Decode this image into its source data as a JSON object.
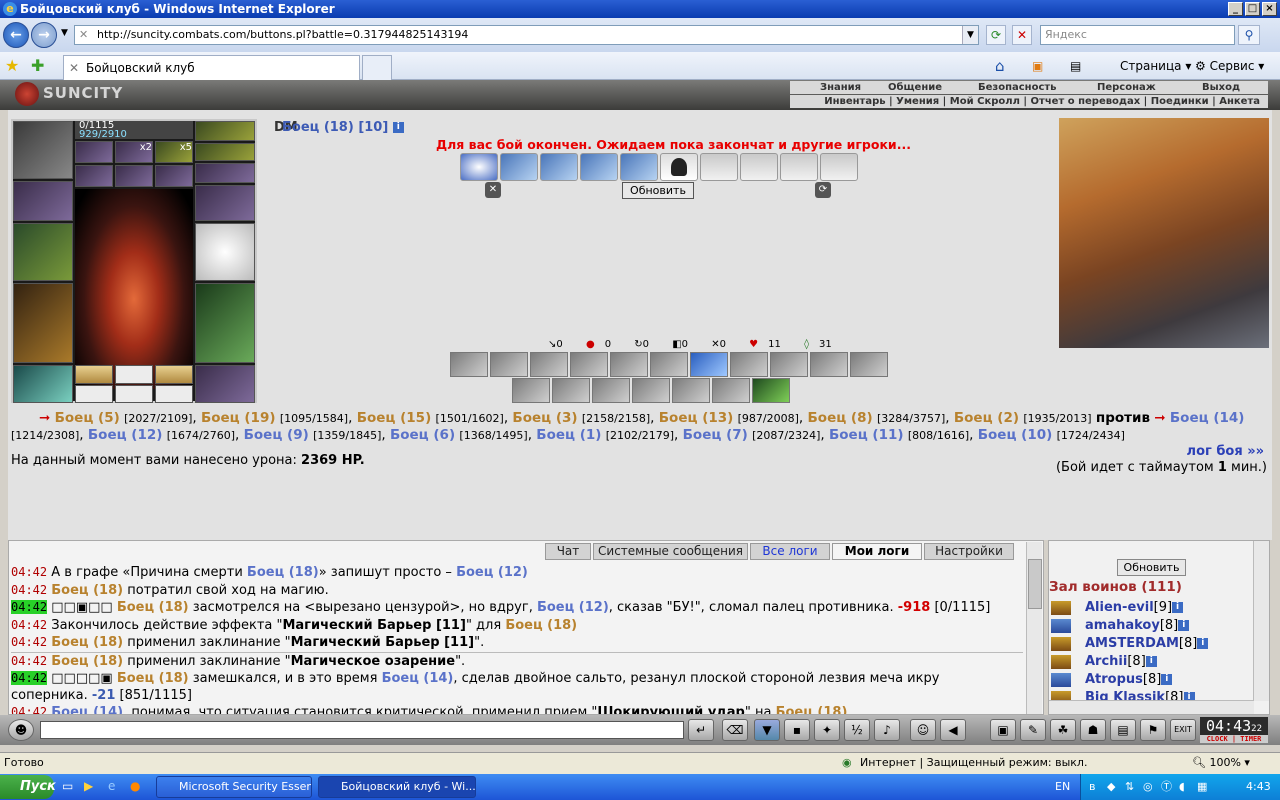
{
  "window": {
    "title": "Бойцовский клуб - Windows Internet Explorer"
  },
  "browser": {
    "url": "http://suncity.combats.com/buttons.pl?battle=0.317944825143194",
    "search_placeholder": "Яндекс",
    "tab_title": "Бойцовский клуб",
    "cmd_page": "Страница",
    "cmd_service": "Сервис"
  },
  "game": {
    "logo": "SUNCITY",
    "menu_top": [
      "Знания",
      "Общение",
      "Безопасность",
      "Персонаж",
      "Выход"
    ],
    "menu_bottom": "Инвентарь | Умения | Мой Скролл | Отчет о переводах | Поединки | Анкета",
    "hp": "0/1115",
    "mp": "929/2910",
    "slot_x2": "x2",
    "slot_x5": "x5",
    "mb": "DM",
    "player_name": "Боец (18) [10]",
    "end_message": "Для вас бой окончен. Ожидаем пока закончат и другие игроки...",
    "refresh": "Обновить",
    "counters": [
      "0",
      "0",
      "0",
      "0",
      "0",
      "11",
      "31"
    ],
    "team1": [
      {
        "name": "Боец (5)",
        "hp": "[2027/2109]"
      },
      {
        "name": "Боец (19)",
        "hp": "[1095/1584]"
      },
      {
        "name": "Боец (15)",
        "hp": "[1501/1602]"
      },
      {
        "name": "Боец (3)",
        "hp": "[2158/2158]"
      },
      {
        "name": "Боец (13)",
        "hp": "[987/2008]"
      },
      {
        "name": "Боец (8)",
        "hp": "[3284/3757]"
      },
      {
        "name": "Боец (2)",
        "hp": "[1935/2013]"
      }
    ],
    "vs": "против",
    "team2": [
      {
        "name": "Боец (14)",
        "hp": "[1214/2308]"
      },
      {
        "name": "Боец (12)",
        "hp": "[1674/2760]"
      },
      {
        "name": "Боец (9)",
        "hp": "[1359/1845]"
      },
      {
        "name": "Боец (6)",
        "hp": "[1368/1495]"
      },
      {
        "name": "Боец (1)",
        "hp": "[2102/2179]"
      },
      {
        "name": "Боец (7)",
        "hp": "[2087/2324]"
      },
      {
        "name": "Боец (11)",
        "hp": "[808/1616]"
      },
      {
        "name": "Боец (10)",
        "hp": "[1724/2434]"
      }
    ],
    "damage_label": "На данный момент вами нанесено урона:",
    "damage_value": "2369 HP.",
    "log_link": "лог боя »»",
    "timeout": "(Бой идет с таймаутом",
    "timeout_value": "1",
    "timeout_unit": "мин.)"
  },
  "log_tabs": [
    "Чат",
    "Системные сообщения",
    "Все логи",
    "Мои логи",
    "Настройки"
  ],
  "log": {
    "time": "04:42",
    "l1a": "А в графе «Причина смерти",
    "l1b": "Боец (18)",
    "l1c": "» запишут просто –",
    "l1d": "Боец (12)",
    "l2a": "Боец (18)",
    "l2b": "потратил свой ход на магию.",
    "l3pre": "□□▣□□",
    "l3a": "Боец (18)",
    "l3b": "засмотрелся на <вырезано цензурой>, но вдруг,",
    "l3c": "Боец (12)",
    "l3d": ", сказав \"БУ!\", сломал палец противника.",
    "l3dmg": "-918",
    "l3hp": "[0/1115]",
    "l4a": "Закончилось действие эффекта \"",
    "l4b": "Магический Барьер [11]",
    "l4c": "\" для",
    "l4d": "Боец (18)",
    "l5a": "Боец (18)",
    "l5b": "применил заклинание \"",
    "l5c": "Магический Барьер [11]",
    "l5d": "\".",
    "l6a": "Боец (18)",
    "l6b": "применил заклинание \"",
    "l6c": "Магическое озарение",
    "l6d": "\".",
    "l7pre": "□□□□▣",
    "l7a": "Боец (18)",
    "l7b": "замешкался, и в это время",
    "l7c": "Боец (14)",
    "l7d": ", сделав двойное сальто, резанул плоской стороной лезвия меча икру",
    "l7e": "соперника.",
    "l7dmg": "-21",
    "l7hp": "[851/1115]",
    "l8a": "Боец (14)",
    "l8b": ", понимая, что ситуация становится критической, применил прием \"",
    "l8c": "Шокирующий удар",
    "l8d": "\" на",
    "l8e": "Боец (18)",
    "l8f": "."
  },
  "hall": {
    "refresh": "Обновить",
    "title": "Зал воинов (111)",
    "players": [
      {
        "name": "Alien-evil",
        "lvl": "[9]"
      },
      {
        "name": "amahakoy",
        "lvl": "[8]"
      },
      {
        "name": "AMSTERDAM",
        "lvl": "[8]"
      },
      {
        "name": "Archii",
        "lvl": "[8]"
      },
      {
        "name": "Atropus",
        "lvl": "[8]"
      },
      {
        "name": "Big Klassik",
        "lvl": "[8]"
      }
    ]
  },
  "clock": {
    "time": "04:43",
    "sec": "22",
    "label": "CLOCK | TIMER"
  },
  "statusbar": {
    "ready": "Готово",
    "zone": "Интернет | Защищенный режим: выкл.",
    "zoom": "100%"
  },
  "taskbar": {
    "start": "Пуск",
    "tasks": [
      "Microsoft Security Essen...",
      "Бойцовский клуб - Wi..."
    ],
    "lang": "EN",
    "time": "4:43"
  }
}
